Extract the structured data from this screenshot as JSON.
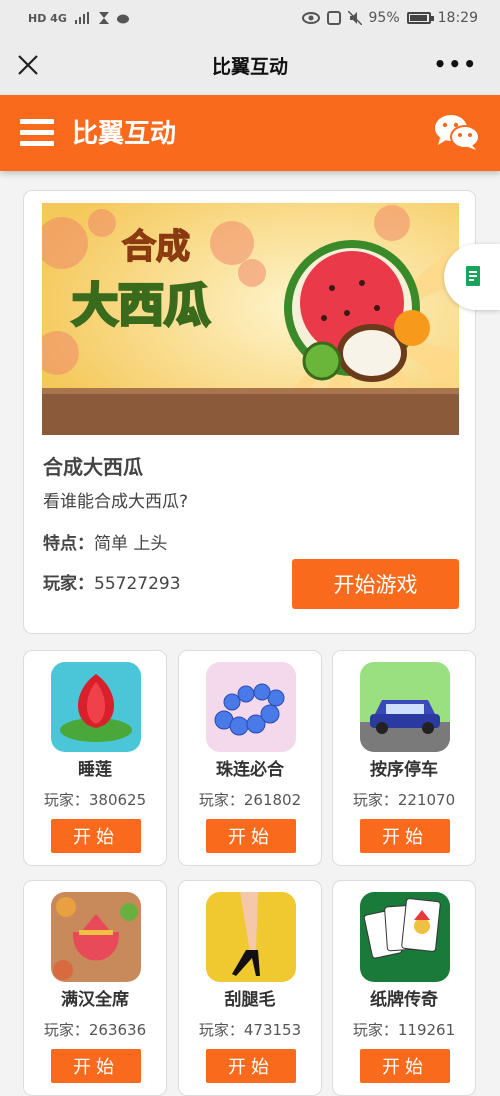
{
  "status_bar": {
    "left": "HD 4G",
    "battery": "95%",
    "time": "18:29"
  },
  "titlebar": {
    "title": "比翼互动",
    "more": "•••"
  },
  "header": {
    "brand": "比翼互动"
  },
  "feature": {
    "name": "合成大西瓜",
    "desc": "看谁能合成大西瓜?",
    "feat_label": "特点：",
    "feat_value": "简单 上头",
    "players_label": "玩家：",
    "players_value": "55727293",
    "button": "开始游戏",
    "banner_line1": "合成",
    "banner_line2": "大西瓜"
  },
  "games": [
    {
      "name": "睡莲",
      "players": "玩家：380625",
      "button": "开始"
    },
    {
      "name": "珠连必合",
      "players": "玩家：261802",
      "button": "开始"
    },
    {
      "name": "按序停车",
      "players": "玩家：221070",
      "button": "开始"
    },
    {
      "name": "满汉全席",
      "players": "玩家：263636",
      "button": "开始"
    },
    {
      "name": "刮腿毛",
      "players": "玩家：473153",
      "button": "开始"
    },
    {
      "name": "纸牌传奇",
      "players": "玩家：119261",
      "button": "开始"
    }
  ]
}
